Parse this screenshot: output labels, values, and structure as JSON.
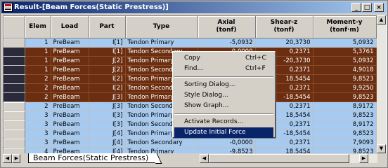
{
  "window": {
    "title": "Result-[Beam Forces(Static Prestress)]"
  },
  "table": {
    "columns": [
      "Elem",
      "Load",
      "Part",
      "Type",
      "Axial\n(tonf)",
      "Shear-z\n(tonf)",
      "Moment-y\n(tonf·m)"
    ],
    "rows": [
      {
        "style": "blue",
        "cells": [
          "1",
          "PreBeam",
          "I[1]",
          "Tendon Primary",
          "-5,0932",
          "20,3730",
          "5,0932"
        ]
      },
      {
        "style": "brown",
        "cells": [
          "1",
          "PreBeam",
          "I[1]",
          "Tendon Secondary",
          "0,0000",
          "0,2371",
          "5,3761"
        ]
      },
      {
        "style": "brown",
        "cells": [
          "1",
          "PreBeam",
          "J[2]",
          "Tendon Primary",
          "",
          "-20,3730",
          "5,0932"
        ]
      },
      {
        "style": "brown",
        "cells": [
          "1",
          "PreBeam",
          "J[2]",
          "Tendon Secondary",
          "",
          "0,2371",
          "4,9018"
        ]
      },
      {
        "style": "brown",
        "cells": [
          "2",
          "PreBeam",
          "I[2]",
          "Tendon Primary",
          "",
          "18,5454",
          "9,8523"
        ]
      },
      {
        "style": "brown",
        "cells": [
          "2",
          "PreBeam",
          "I[2]",
          "Tendon Secondary",
          "",
          "0,2371",
          "9,9250"
        ]
      },
      {
        "style": "brown",
        "cells": [
          "2",
          "PreBeam",
          "J[3]",
          "Tendon Primary",
          "",
          "-18,5454",
          "9,8523"
        ]
      },
      {
        "style": "blue",
        "cells": [
          "2",
          "PreBeam",
          "J[3]",
          "Tendon Secondary",
          "",
          "0,2371",
          "8,9172"
        ]
      },
      {
        "style": "blue",
        "cells": [
          "3",
          "PreBeam",
          "I[3]",
          "Tendon Primary",
          "",
          "18,5454",
          "9,8523"
        ]
      },
      {
        "style": "blue",
        "cells": [
          "3",
          "PreBeam",
          "I[3]",
          "Tendon Secondary",
          "",
          "0,2371",
          "8,9172"
        ]
      },
      {
        "style": "blue",
        "cells": [
          "3",
          "PreBeam",
          "J[4]",
          "Tendon Primary",
          "",
          "-18,5454",
          "9,8523"
        ]
      },
      {
        "style": "blue",
        "cells": [
          "3",
          "PreBeam",
          "J[4]",
          "Tendon Secondary",
          "-0,0000",
          "0,2371",
          "7,9093"
        ]
      },
      {
        "style": "blue",
        "cells": [
          "4",
          "PreBeam",
          "I[4]",
          "Tendon Primary",
          "-9,8523",
          "18,5454",
          "9,8523"
        ]
      }
    ]
  },
  "context_menu": {
    "items": [
      {
        "label": "Copy",
        "shortcut": "Ctrl+C"
      },
      {
        "label": "Find...",
        "shortcut": "Ctrl+F"
      },
      {
        "sep": true
      },
      {
        "label": "Sorting Dialog...",
        "shortcut": ""
      },
      {
        "label": "Style Dialog...",
        "shortcut": ""
      },
      {
        "label": "Show Graph...",
        "shortcut": ""
      },
      {
        "sep": true
      },
      {
        "label": "Activate Records...",
        "shortcut": ""
      },
      {
        "label": "Update Initial Force",
        "shortcut": "",
        "highlighted": true
      }
    ]
  },
  "sheet_tab": {
    "label": "Beam Forces(Static Prestress)"
  },
  "icons": [
    "app-icon",
    "minimize-icon",
    "maximize-icon",
    "close-icon",
    "scroll-up-icon",
    "scroll-down-icon",
    "scroll-left-icon",
    "scroll-right-icon",
    "tab-first-icon",
    "tab-prev-icon",
    "tab-next-icon",
    "tab-last-icon"
  ],
  "colors": {
    "selected_row": "#6b2e10",
    "normal_row": "#a6caf0",
    "titlebar": "#0a246a",
    "menu_highlight": "#0a246a"
  }
}
